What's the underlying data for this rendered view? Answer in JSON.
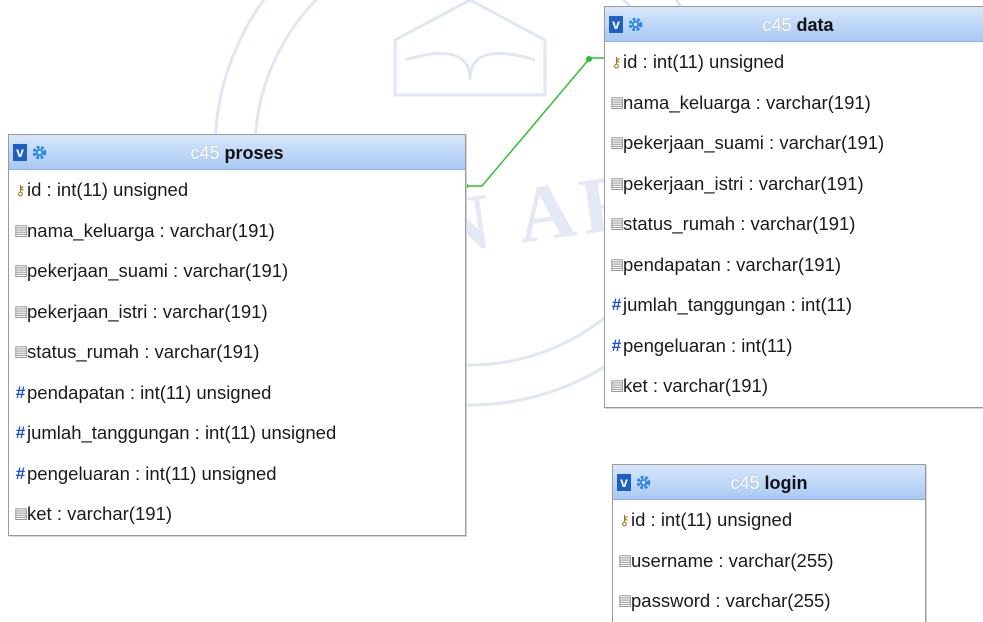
{
  "watermark": {
    "text": "MEDAN AREA"
  },
  "tables": {
    "proses": {
      "db": "c45",
      "name": "proses",
      "toggle": "v",
      "icon": "gear-icon",
      "columns": [
        {
          "icon": "key-icon",
          "name": "id",
          "type": " : int(11) unsigned"
        },
        {
          "icon": "text-field-icon",
          "name": "nama_keluarga",
          "type": " : varchar(191)"
        },
        {
          "icon": "text-field-icon",
          "name": "pekerjaan_suami",
          "type": " : varchar(191)"
        },
        {
          "icon": "text-field-icon",
          "name": "pekerjaan_istri",
          "type": " : varchar(191)"
        },
        {
          "icon": "text-field-icon",
          "name": "status_rumah",
          "type": " : varchar(191)"
        },
        {
          "icon": "numeric-field-icon",
          "name": "pendapatan",
          "type": " : int(11) unsigned"
        },
        {
          "icon": "numeric-field-icon",
          "name": "jumlah_tanggungan",
          "type": " : int(11) unsigned"
        },
        {
          "icon": "numeric-field-icon",
          "name": "pengeluaran",
          "type": " : int(11) unsigned"
        },
        {
          "icon": "text-field-icon",
          "name": "ket",
          "type": " : varchar(191)"
        }
      ]
    },
    "data": {
      "db": "c45",
      "name": "data",
      "toggle": "v",
      "icon": "gear-icon",
      "columns": [
        {
          "icon": "key-icon",
          "name": "id",
          "type": " : int(11) unsigned"
        },
        {
          "icon": "text-field-icon",
          "name": "nama_keluarga",
          "type": " : varchar(191)"
        },
        {
          "icon": "text-field-icon",
          "name": "pekerjaan_suami",
          "type": " : varchar(191)"
        },
        {
          "icon": "text-field-icon",
          "name": "pekerjaan_istri",
          "type": " : varchar(191)"
        },
        {
          "icon": "text-field-icon",
          "name": "status_rumah",
          "type": " : varchar(191)"
        },
        {
          "icon": "text-field-icon",
          "name": "pendapatan",
          "type": " : varchar(191)"
        },
        {
          "icon": "numeric-field-icon",
          "name": "jumlah_tanggungan",
          "type": " : int(11)"
        },
        {
          "icon": "numeric-field-icon",
          "name": "pengeluaran",
          "type": " : int(11)"
        },
        {
          "icon": "text-field-icon",
          "name": "ket",
          "type": " : varchar(191)"
        }
      ]
    },
    "login": {
      "db": "c45",
      "name": "login",
      "toggle": "v",
      "icon": "gear-icon",
      "columns": [
        {
          "icon": "key-icon",
          "name": "id",
          "type": " : int(11) unsigned"
        },
        {
          "icon": "text-field-icon",
          "name": "username",
          "type": " : varchar(255)"
        },
        {
          "icon": "text-field-icon",
          "name": "password",
          "type": " : varchar(255)"
        }
      ]
    }
  },
  "colors": {
    "header_top": "#d7e7fb",
    "header_bottom": "#a9c9f3",
    "toggle": "#1e5fc4",
    "relation_line": "#2ec02e",
    "numeric_icon": "#1f4fd6"
  }
}
